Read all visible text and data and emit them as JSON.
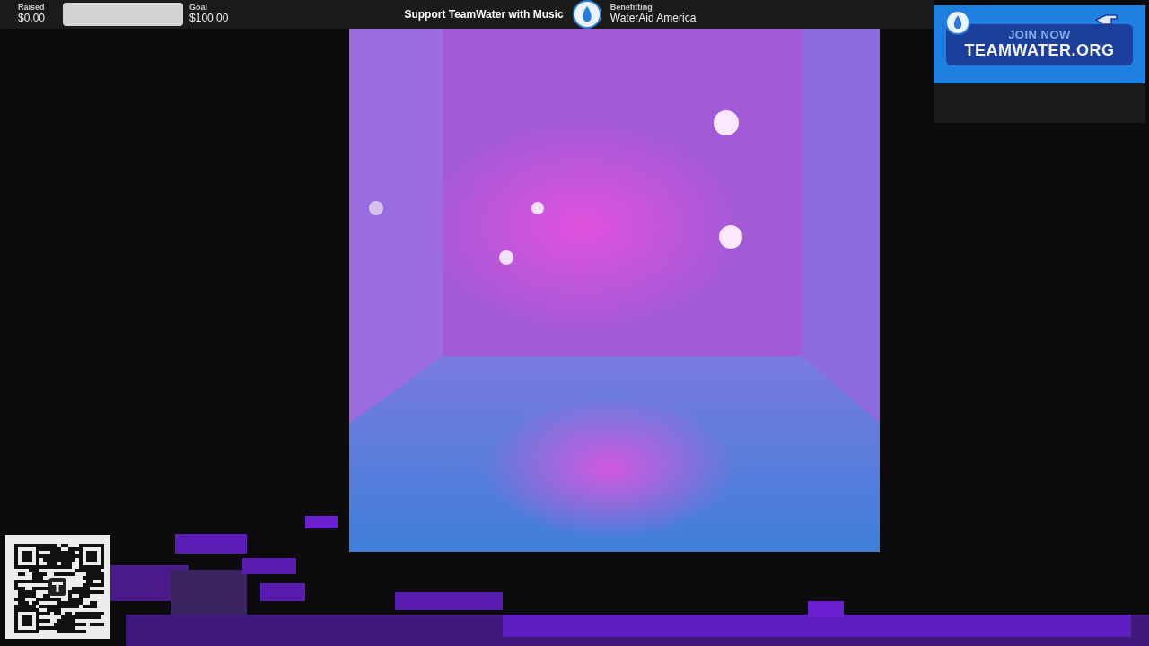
{
  "fundraiser": {
    "raised_label": "Raised",
    "raised": "$0.00",
    "progress": {
      "level": 0
    },
    "goal_label": "Goal",
    "goal": "$100.00",
    "title": "Support TeamWater with Music",
    "benefitting_label": "Benefitting",
    "beneficiary": "WaterAid America"
  },
  "banner": {
    "kicker": "JOIN NOW",
    "url": "TEAMWATER.ORG"
  }
}
